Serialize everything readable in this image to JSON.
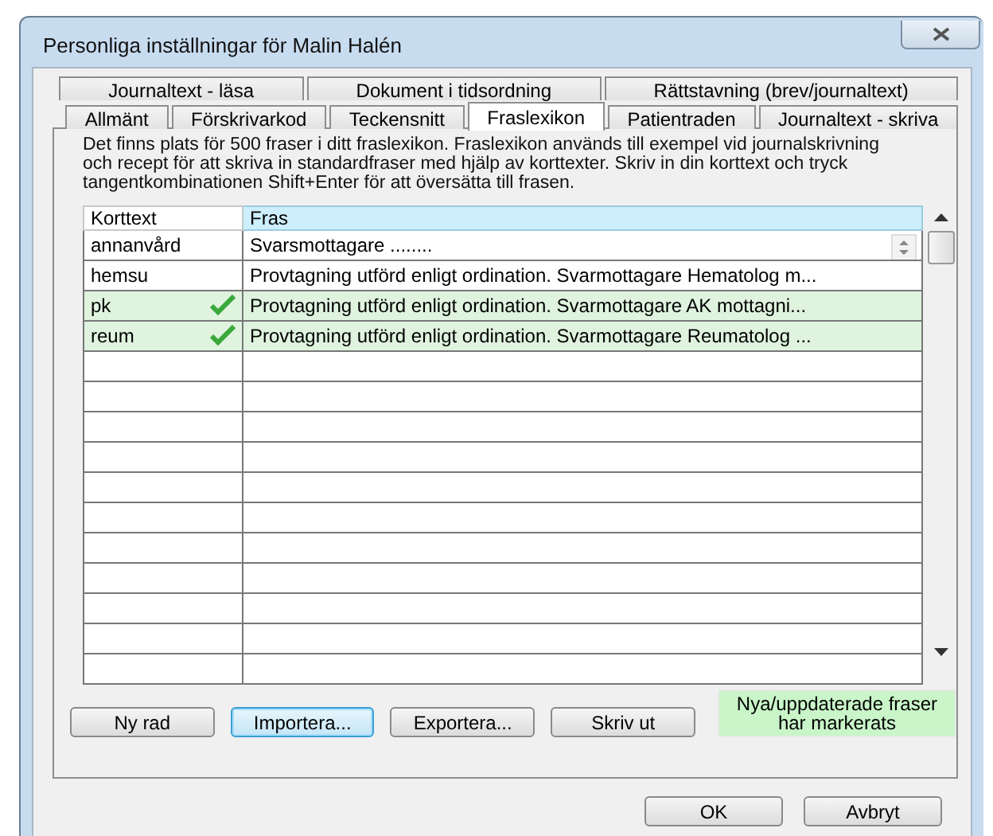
{
  "window": {
    "title": "Personliga inställningar för Malin Halén"
  },
  "tab_rows": [
    [
      {
        "label": "Journaltext - läsa",
        "selected": false
      },
      {
        "label": "Dokument i tidsordning",
        "selected": false
      },
      {
        "label": "Rättstavning (brev/journaltext)",
        "selected": false
      }
    ],
    [
      {
        "label": "Allmänt",
        "selected": false
      },
      {
        "label": "Förskrivarkod",
        "selected": false
      },
      {
        "label": "Teckensnitt",
        "selected": false
      },
      {
        "label": "Fraslexikon",
        "selected": true
      },
      {
        "label": "Patientraden",
        "selected": false
      },
      {
        "label": "Journaltext - skriva",
        "selected": false
      }
    ]
  ],
  "description": "Det finns plats för 500 fraser i ditt fraslexikon. Fraslexikon används till exempel vid journalskrivning och recept för att skriva in standardfraser med hjälp av korttexter. Skriv in din korttext och tryck tangentkombinationen Shift+Enter för att översätta till frasen.",
  "table": {
    "columns": [
      "Korttext",
      "Fras"
    ],
    "rows": [
      {
        "short": "annanvård",
        "phrase": "Svarsmottagare ........",
        "marked": false,
        "editing": true
      },
      {
        "short": "hemsu",
        "phrase": "Provtagning utförd enligt ordination. Svarmottagare Hematolog m...",
        "marked": false,
        "editing": false
      },
      {
        "short": "pk",
        "phrase": "Provtagning utförd enligt ordination. Svarmottagare AK mottagni...",
        "marked": true,
        "editing": false
      },
      {
        "short": "reum",
        "phrase": "Provtagning utförd enligt ordination. Svarmottagare Reumatolog ...",
        "marked": true,
        "editing": false
      }
    ]
  },
  "buttons": [
    {
      "label": "Ny rad",
      "focused": false
    },
    {
      "label": "Importera...",
      "focused": true
    },
    {
      "label": "Exportera...",
      "focused": false
    },
    {
      "label": "Skriv ut",
      "focused": false
    }
  ],
  "legend": "Nya/uppdaterade fraser har markerats",
  "dialog_buttons": [
    "OK",
    "Avbryt"
  ]
}
